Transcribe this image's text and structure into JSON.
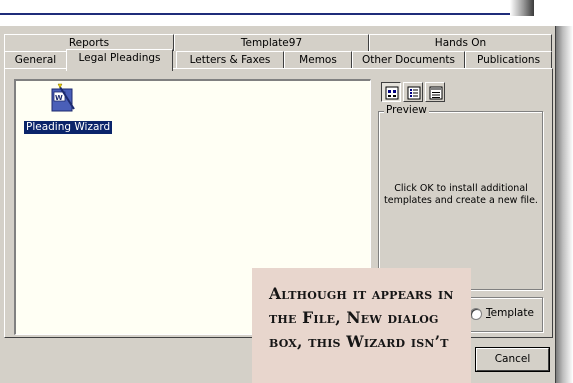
{
  "tabs": {
    "row1": [
      {
        "label": "Reports"
      },
      {
        "label": "Template97"
      },
      {
        "label": "Hands On"
      }
    ],
    "row2": [
      {
        "label": "General"
      },
      {
        "label": "Legal Pleadings"
      },
      {
        "label": "Letters & Faxes"
      },
      {
        "label": "Memos"
      },
      {
        "label": "Other Documents"
      },
      {
        "label": "Publications"
      }
    ],
    "active": "Legal Pleadings"
  },
  "files": [
    {
      "label": "Pleading Wizard",
      "icon": "word-wizard-icon",
      "selected": true
    }
  ],
  "view_buttons": [
    {
      "icon": "large-icons-view-icon",
      "pressed": true
    },
    {
      "icon": "list-view-icon",
      "pressed": false
    },
    {
      "icon": "details-view-icon",
      "pressed": false
    }
  ],
  "preview": {
    "legend": "Preview",
    "message": "Click OK to install additional templates and create a new file."
  },
  "create_new": {
    "template_radio_label_first": "T",
    "template_radio_label_rest": "emplate"
  },
  "buttons": {
    "cancel": "Cancel"
  },
  "callout": {
    "text": "Although it appears in the File, New dialog box, this Wizard isn’t"
  },
  "colors": {
    "dialog_face": "#d4d0c8",
    "list_background": "#fffff4",
    "selection": "#0a246a",
    "callout_background": "#e8d6cd",
    "title_line": "#1f2c7a"
  }
}
